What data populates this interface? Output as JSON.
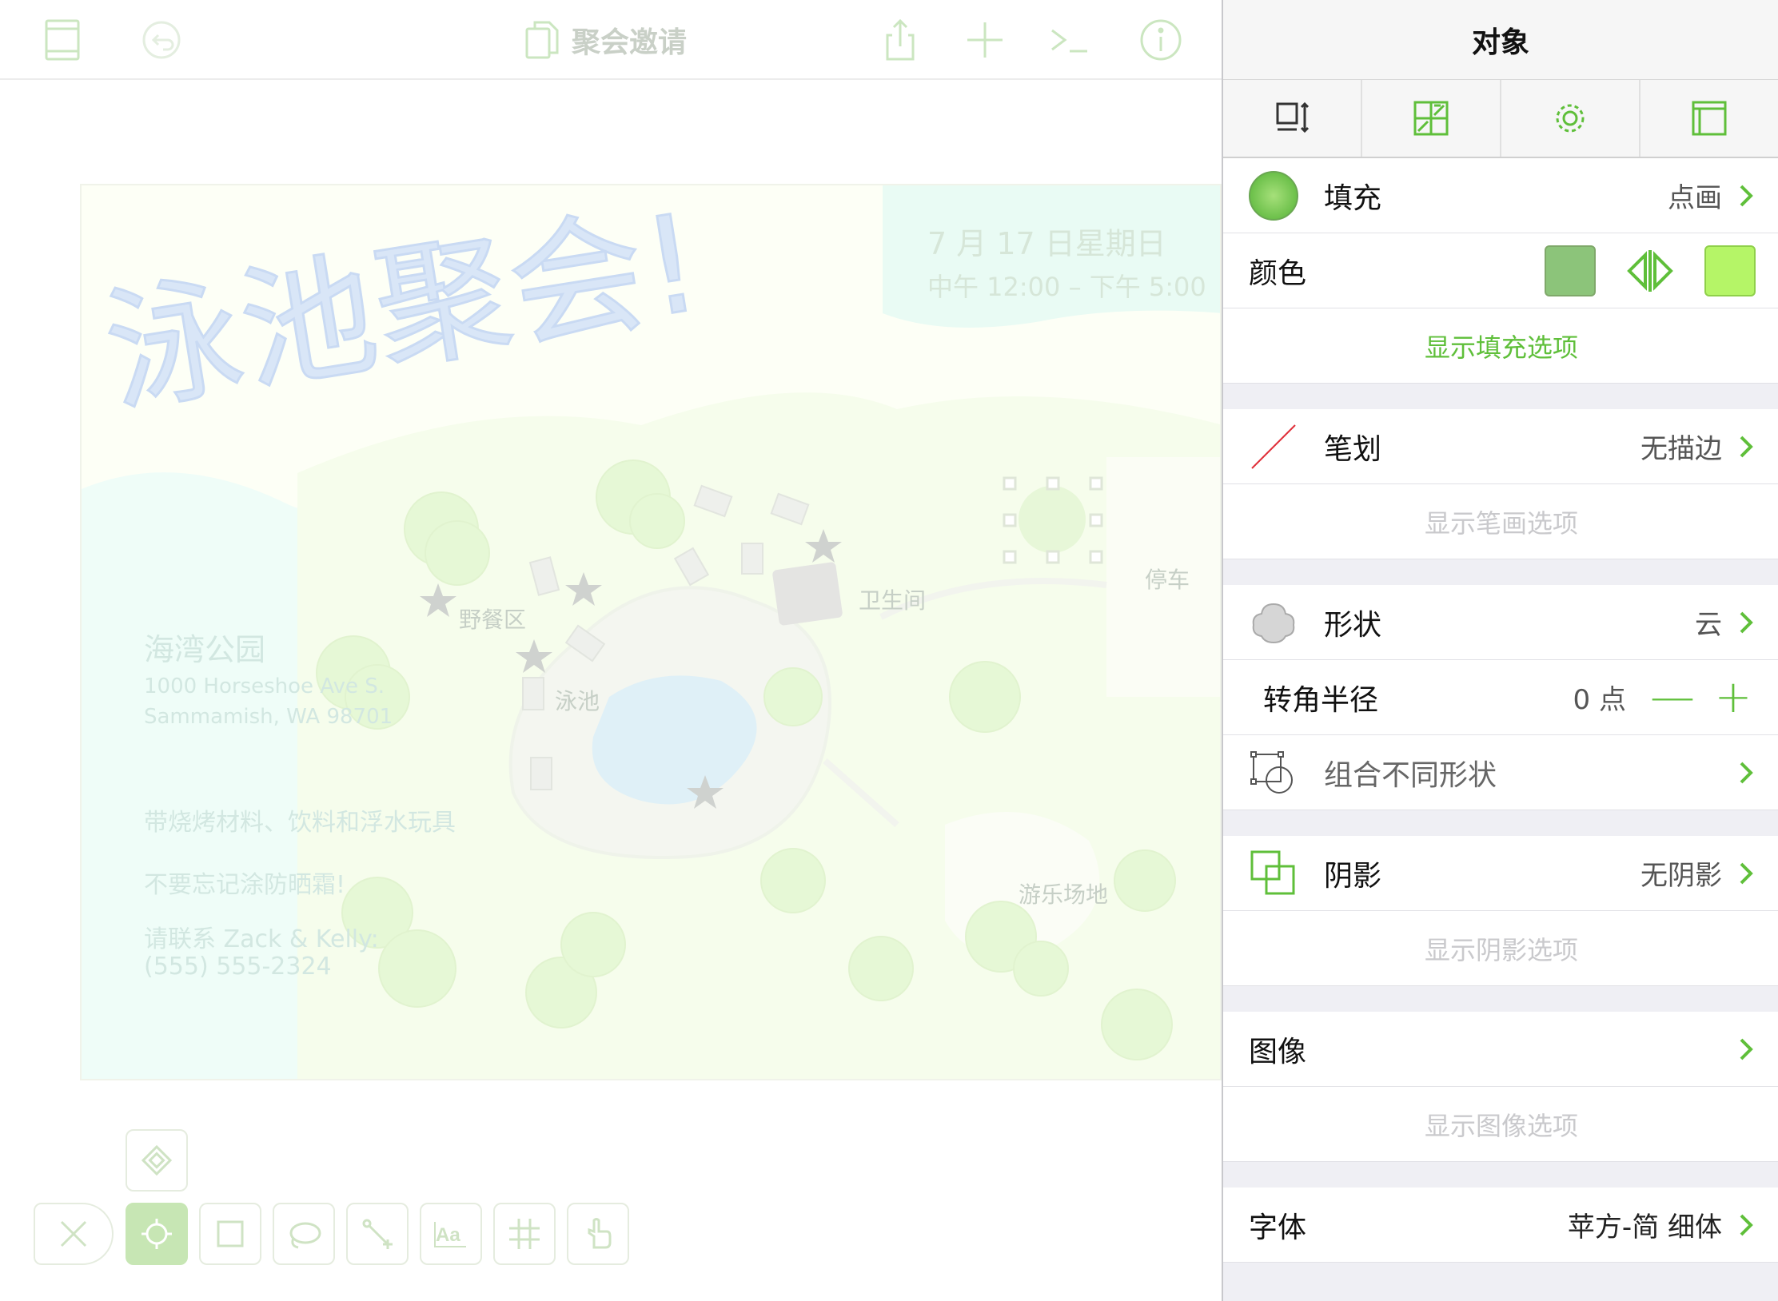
{
  "toolbar": {
    "doc_title": "聚会邀请",
    "icons": [
      "sidebar-icon",
      "undo-icon",
      "copy-icon",
      "share-icon",
      "add-icon",
      "console-icon",
      "info-icon"
    ]
  },
  "document": {
    "title": "泳池聚会!",
    "date": "7 月 17 日星期日",
    "time": "中午 12:00 –  下午 5:00",
    "park_name": "海湾公园",
    "address_line1": "1000 Horseshoe Ave S.",
    "address_line2": "Sammamish, WA 98701",
    "note_bring": "带烧烤材料、饮料和浮水玩具",
    "note_sunscreen": "不要忘记涂防晒霜!",
    "contact_line1": "请联系 Zack & Kelly:",
    "contact_line2": "(555) 555-2324",
    "map_labels": {
      "picnic": "野餐区",
      "restroom": "卫生间",
      "pool": "泳池",
      "parking": "停车",
      "playground": "游乐场地"
    }
  },
  "tools": [
    "pen-tool",
    "select-tool",
    "rectangle-tool",
    "lasso-tool",
    "connect-tool",
    "text-tool",
    "grid-tool",
    "hand-tool",
    "style-tool"
  ],
  "inspector": {
    "title": "对象",
    "tabs": [
      "arrange-tab-icon",
      "fill-style-tab-icon",
      "settings-tab-icon",
      "canvas-tab-icon"
    ],
    "fill": {
      "label": "填充",
      "value": "点画",
      "show_options": "显示填充选项"
    },
    "color": {
      "label": "颜色",
      "color_a": "#8cc47a",
      "color_b": "#b5f567"
    },
    "stroke": {
      "label": "笔划",
      "value": "无描边",
      "show_options": "显示笔画选项"
    },
    "shape": {
      "label": "形状",
      "value": "云"
    },
    "corner_radius": {
      "label": "转角半径",
      "value": "0 点"
    },
    "combine": {
      "label": "组合不同形状"
    },
    "shadow": {
      "label": "阴影",
      "value": "无阴影",
      "show_options": "显示阴影选项"
    },
    "image": {
      "label": "图像",
      "show_options": "显示图像选项"
    },
    "font": {
      "label": "字体",
      "value": "苹方-简 细体"
    },
    "accent_color": "#5fbf3a"
  }
}
